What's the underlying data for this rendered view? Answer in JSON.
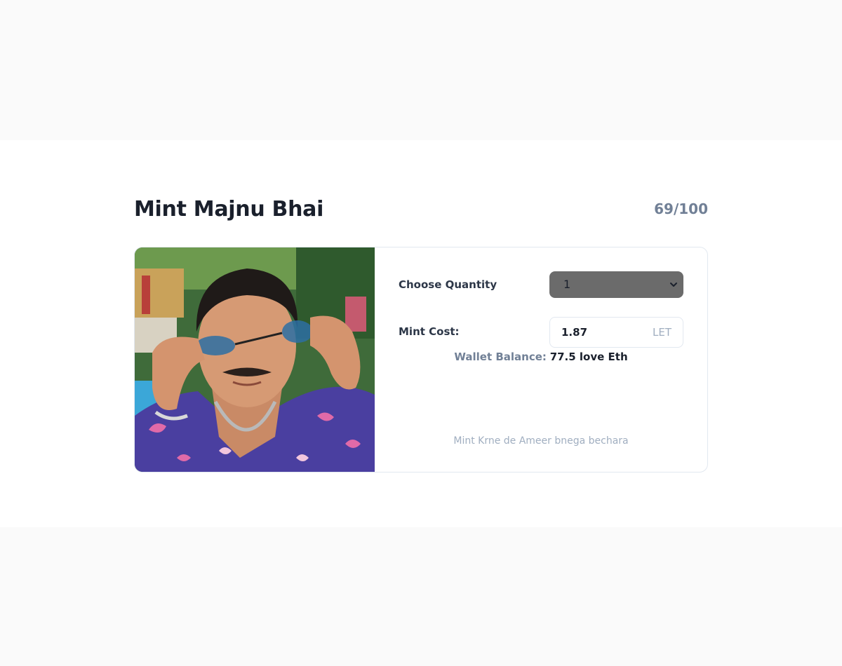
{
  "header": {
    "title": "Mint Majnu Bhai",
    "minted_count": "69/100"
  },
  "mint_card": {
    "image": {
      "subject": "man-with-sunglasses-portrait"
    },
    "quantity": {
      "label": "Choose Quantity",
      "selected": "1"
    },
    "cost": {
      "label": "Mint Cost:",
      "value": "1.87",
      "unit": "LET"
    },
    "wallet": {
      "label": "Wallet Balance:",
      "value": "77.5 love Eth"
    },
    "footer_note": "Mint Krne de Ameer bnega bechara"
  },
  "colors": {
    "page_background": "#fafafa",
    "card_border": "#e2e8f0",
    "select_background": "#6b6b6b",
    "title_text": "#1a202c",
    "muted_text": "#718096"
  }
}
